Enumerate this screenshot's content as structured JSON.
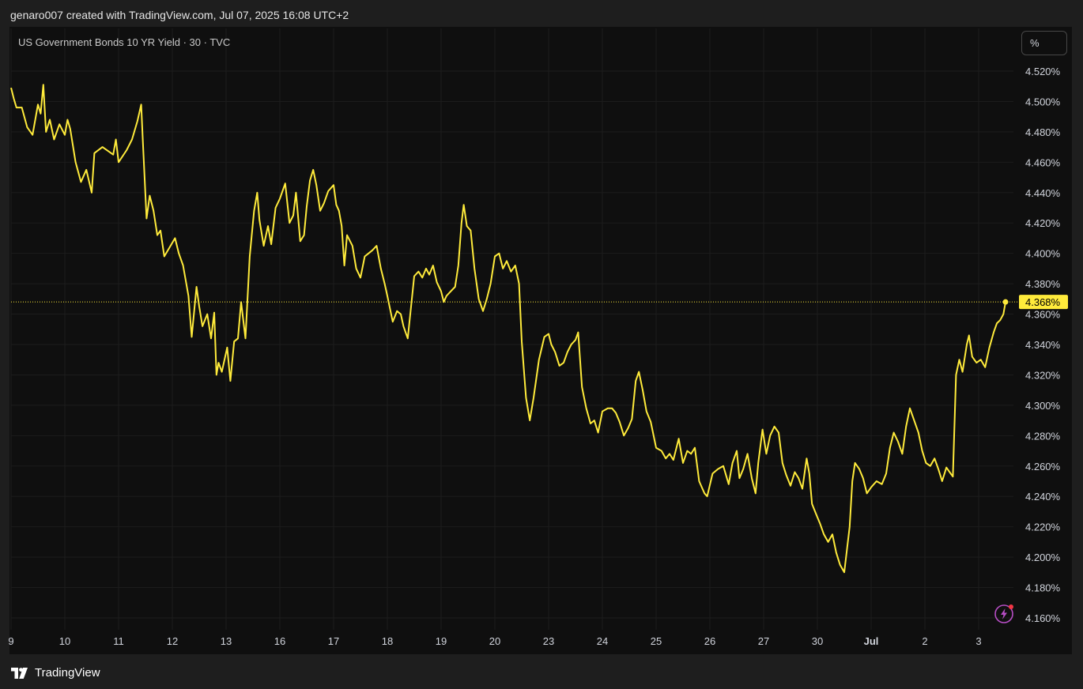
{
  "header": {
    "attribution": "genaro007 created with TradingView.com, Jul 07, 2025 16:08 UTC+2"
  },
  "legend": {
    "title": "US Government Bonds 10 YR Yield · 30 · TVC"
  },
  "unit_button": {
    "label": "%"
  },
  "footer": {
    "brand": "TradingView"
  },
  "icons": {
    "alert": "lightning-alert-icon",
    "logo": "tradingview-logo-icon"
  },
  "colors": {
    "line": "#ffeb3b",
    "background": "#0f0f0f",
    "frame": "#1e1e1e",
    "grid": "#1c1c1c",
    "text": "#d1d4dc",
    "price_label_bg": "#ffeb3b",
    "alert": "#b84ec6",
    "alert_dot": "#f23645"
  },
  "chart_data": {
    "type": "line",
    "title": "US Government Bonds 10 YR Yield · 30 · TVC",
    "x_categories": [
      "9",
      "10",
      "11",
      "12",
      "13",
      "16",
      "17",
      "18",
      "19",
      "20",
      "23",
      "24",
      "25",
      "26",
      "27",
      "30",
      "Jul",
      "2",
      "3"
    ],
    "y_ticks": [
      "4.160%",
      "4.180%",
      "4.200%",
      "4.220%",
      "4.240%",
      "4.260%",
      "4.280%",
      "4.300%",
      "4.320%",
      "4.340%",
      "4.360%",
      "4.380%",
      "4.400%",
      "4.420%",
      "4.440%",
      "4.460%",
      "4.480%",
      "4.500%",
      "4.520%"
    ],
    "ylim": [
      4.16,
      4.52
    ],
    "unit": "%",
    "grid": true,
    "last_value": 4.368,
    "last_value_label": "4.368%",
    "series": [
      {
        "points": [
          [
            0.0,
            4.509
          ],
          [
            0.05,
            4.502
          ],
          [
            0.1,
            4.496
          ],
          [
            0.2,
            4.496
          ],
          [
            0.3,
            4.483
          ],
          [
            0.4,
            4.478
          ],
          [
            0.5,
            4.498
          ],
          [
            0.55,
            4.492
          ],
          [
            0.6,
            4.511
          ],
          [
            0.65,
            4.48
          ],
          [
            0.72,
            4.488
          ],
          [
            0.8,
            4.475
          ],
          [
            0.9,
            4.485
          ],
          [
            1.0,
            4.478
          ],
          [
            1.05,
            4.488
          ],
          [
            1.1,
            4.482
          ],
          [
            1.2,
            4.46
          ],
          [
            1.3,
            4.447
          ],
          [
            1.4,
            4.455
          ],
          [
            1.5,
            4.44
          ],
          [
            1.55,
            4.466
          ],
          [
            1.7,
            4.47
          ],
          [
            1.9,
            4.465
          ],
          [
            1.95,
            4.475
          ],
          [
            2.0,
            4.46
          ],
          [
            2.15,
            4.468
          ],
          [
            2.25,
            4.475
          ],
          [
            2.35,
            4.487
          ],
          [
            2.42,
            4.498
          ],
          [
            2.45,
            4.475
          ],
          [
            2.52,
            4.423
          ],
          [
            2.58,
            4.438
          ],
          [
            2.65,
            4.428
          ],
          [
            2.72,
            4.412
          ],
          [
            2.78,
            4.415
          ],
          [
            2.85,
            4.398
          ],
          [
            2.95,
            4.404
          ],
          [
            3.05,
            4.41
          ],
          [
            3.12,
            4.4
          ],
          [
            3.2,
            4.392
          ],
          [
            3.3,
            4.372
          ],
          [
            3.36,
            4.345
          ],
          [
            3.45,
            4.378
          ],
          [
            3.5,
            4.365
          ],
          [
            3.56,
            4.352
          ],
          [
            3.65,
            4.36
          ],
          [
            3.72,
            4.344
          ],
          [
            3.78,
            4.361
          ],
          [
            3.82,
            4.32
          ],
          [
            3.86,
            4.328
          ],
          [
            3.92,
            4.322
          ],
          [
            4.02,
            4.338
          ],
          [
            4.08,
            4.316
          ],
          [
            4.15,
            4.342
          ],
          [
            4.22,
            4.344
          ],
          [
            4.28,
            4.368
          ],
          [
            4.36,
            4.344
          ],
          [
            4.44,
            4.398
          ],
          [
            4.52,
            4.428
          ],
          [
            4.58,
            4.44
          ],
          [
            4.62,
            4.422
          ],
          [
            4.7,
            4.405
          ],
          [
            4.78,
            4.418
          ],
          [
            4.84,
            4.406
          ],
          [
            4.92,
            4.43
          ],
          [
            5.0,
            4.436
          ],
          [
            5.1,
            4.446
          ],
          [
            5.18,
            4.42
          ],
          [
            5.25,
            4.425
          ],
          [
            5.3,
            4.44
          ],
          [
            5.38,
            4.408
          ],
          [
            5.45,
            4.412
          ],
          [
            5.5,
            4.431
          ],
          [
            5.56,
            4.448
          ],
          [
            5.62,
            4.455
          ],
          [
            5.68,
            4.445
          ],
          [
            5.75,
            4.428
          ],
          [
            5.82,
            4.433
          ],
          [
            5.9,
            4.441
          ],
          [
            6.0,
            4.445
          ],
          [
            6.05,
            4.432
          ],
          [
            6.1,
            4.428
          ],
          [
            6.15,
            4.418
          ],
          [
            6.2,
            4.392
          ],
          [
            6.25,
            4.412
          ],
          [
            6.35,
            4.405
          ],
          [
            6.42,
            4.39
          ],
          [
            6.5,
            4.384
          ],
          [
            6.58,
            4.398
          ],
          [
            6.65,
            4.4
          ],
          [
            6.72,
            4.402
          ],
          [
            6.8,
            4.405
          ],
          [
            6.88,
            4.39
          ],
          [
            6.95,
            4.38
          ],
          [
            7.0,
            4.372
          ],
          [
            7.1,
            4.355
          ],
          [
            7.18,
            4.362
          ],
          [
            7.25,
            4.36
          ],
          [
            7.3,
            4.352
          ],
          [
            7.38,
            4.344
          ],
          [
            7.45,
            4.368
          ],
          [
            7.5,
            4.385
          ],
          [
            7.58,
            4.388
          ],
          [
            7.65,
            4.384
          ],
          [
            7.72,
            4.39
          ],
          [
            7.78,
            4.386
          ],
          [
            7.85,
            4.392
          ],
          [
            7.92,
            4.381
          ],
          [
            8.0,
            4.375
          ],
          [
            8.05,
            4.368
          ],
          [
            8.1,
            4.372
          ],
          [
            8.18,
            4.375
          ],
          [
            8.26,
            4.378
          ],
          [
            8.32,
            4.392
          ],
          [
            8.38,
            4.42
          ],
          [
            8.42,
            4.432
          ],
          [
            8.48,
            4.418
          ],
          [
            8.55,
            4.415
          ],
          [
            8.62,
            4.39
          ],
          [
            8.7,
            4.37
          ],
          [
            8.78,
            4.362
          ],
          [
            8.85,
            4.37
          ],
          [
            8.92,
            4.38
          ],
          [
            9.0,
            4.398
          ],
          [
            9.08,
            4.4
          ],
          [
            9.15,
            4.39
          ],
          [
            9.22,
            4.395
          ],
          [
            9.3,
            4.388
          ],
          [
            9.38,
            4.392
          ],
          [
            9.45,
            4.38
          ],
          [
            9.5,
            4.342
          ],
          [
            9.58,
            4.305
          ],
          [
            9.65,
            4.29
          ],
          [
            9.72,
            4.305
          ],
          [
            9.82,
            4.33
          ],
          [
            9.92,
            4.345
          ],
          [
            10.0,
            4.347
          ],
          [
            10.05,
            4.34
          ],
          [
            10.12,
            4.335
          ],
          [
            10.2,
            4.326
          ],
          [
            10.28,
            4.328
          ],
          [
            10.35,
            4.335
          ],
          [
            10.42,
            4.34
          ],
          [
            10.5,
            4.343
          ],
          [
            10.55,
            4.348
          ],
          [
            10.62,
            4.312
          ],
          [
            10.7,
            4.298
          ],
          [
            10.78,
            4.288
          ],
          [
            10.85,
            4.29
          ],
          [
            10.92,
            4.282
          ],
          [
            11.0,
            4.296
          ],
          [
            11.1,
            4.298
          ],
          [
            11.18,
            4.298
          ],
          [
            11.25,
            4.295
          ],
          [
            11.32,
            4.289
          ],
          [
            11.4,
            4.28
          ],
          [
            11.48,
            4.285
          ],
          [
            11.55,
            4.291
          ],
          [
            11.62,
            4.316
          ],
          [
            11.68,
            4.322
          ],
          [
            11.75,
            4.31
          ],
          [
            11.82,
            4.296
          ],
          [
            11.9,
            4.289
          ],
          [
            12.0,
            4.272
          ],
          [
            12.1,
            4.27
          ],
          [
            12.18,
            4.265
          ],
          [
            12.25,
            4.268
          ],
          [
            12.32,
            4.264
          ],
          [
            12.42,
            4.278
          ],
          [
            12.5,
            4.262
          ],
          [
            12.58,
            4.27
          ],
          [
            12.65,
            4.268
          ],
          [
            12.72,
            4.272
          ],
          [
            12.8,
            4.25
          ],
          [
            12.9,
            4.242
          ],
          [
            12.95,
            4.24
          ],
          [
            13.05,
            4.255
          ],
          [
            13.15,
            4.258
          ],
          [
            13.25,
            4.26
          ],
          [
            13.35,
            4.248
          ],
          [
            13.42,
            4.262
          ],
          [
            13.5,
            4.27
          ],
          [
            13.55,
            4.252
          ],
          [
            13.62,
            4.258
          ],
          [
            13.7,
            4.268
          ],
          [
            13.78,
            4.252
          ],
          [
            13.85,
            4.242
          ],
          [
            13.9,
            4.262
          ],
          [
            13.98,
            4.284
          ],
          [
            14.05,
            4.268
          ],
          [
            14.12,
            4.28
          ],
          [
            14.2,
            4.286
          ],
          [
            14.28,
            4.282
          ],
          [
            14.35,
            4.262
          ],
          [
            14.42,
            4.254
          ],
          [
            14.5,
            4.247
          ],
          [
            14.58,
            4.256
          ],
          [
            14.65,
            4.252
          ],
          [
            14.72,
            4.245
          ],
          [
            14.8,
            4.265
          ],
          [
            14.85,
            4.255
          ],
          [
            14.9,
            4.235
          ],
          [
            14.98,
            4.228
          ],
          [
            15.05,
            4.222
          ],
          [
            15.12,
            4.215
          ],
          [
            15.2,
            4.21
          ],
          [
            15.28,
            4.215
          ],
          [
            15.35,
            4.203
          ],
          [
            15.42,
            4.195
          ],
          [
            15.5,
            4.19
          ],
          [
            15.55,
            4.205
          ],
          [
            15.6,
            4.22
          ],
          [
            15.65,
            4.25
          ],
          [
            15.7,
            4.262
          ],
          [
            15.78,
            4.258
          ],
          [
            15.85,
            4.252
          ],
          [
            15.92,
            4.242
          ],
          [
            16.0,
            4.246
          ],
          [
            16.1,
            4.25
          ],
          [
            16.2,
            4.248
          ],
          [
            16.28,
            4.255
          ],
          [
            16.35,
            4.272
          ],
          [
            16.42,
            4.282
          ],
          [
            16.5,
            4.276
          ],
          [
            16.58,
            4.268
          ],
          [
            16.65,
            4.286
          ],
          [
            16.72,
            4.298
          ],
          [
            16.8,
            4.29
          ],
          [
            16.88,
            4.282
          ],
          [
            16.95,
            4.27
          ],
          [
            17.02,
            4.262
          ],
          [
            17.1,
            4.26
          ],
          [
            17.18,
            4.265
          ],
          [
            17.25,
            4.258
          ],
          [
            17.32,
            4.25
          ],
          [
            17.4,
            4.259
          ],
          [
            17.46,
            4.256
          ],
          [
            17.52,
            4.253
          ],
          [
            17.58,
            4.32
          ],
          [
            17.64,
            4.33
          ],
          [
            17.7,
            4.322
          ],
          [
            17.78,
            4.34
          ],
          [
            17.82,
            4.346
          ],
          [
            17.88,
            4.332
          ],
          [
            17.96,
            4.328
          ],
          [
            18.04,
            4.33
          ],
          [
            18.12,
            4.325
          ],
          [
            18.2,
            4.338
          ],
          [
            18.28,
            4.348
          ],
          [
            18.34,
            4.354
          ],
          [
            18.4,
            4.356
          ],
          [
            18.46,
            4.36
          ],
          [
            18.5,
            4.368
          ]
        ]
      }
    ]
  }
}
